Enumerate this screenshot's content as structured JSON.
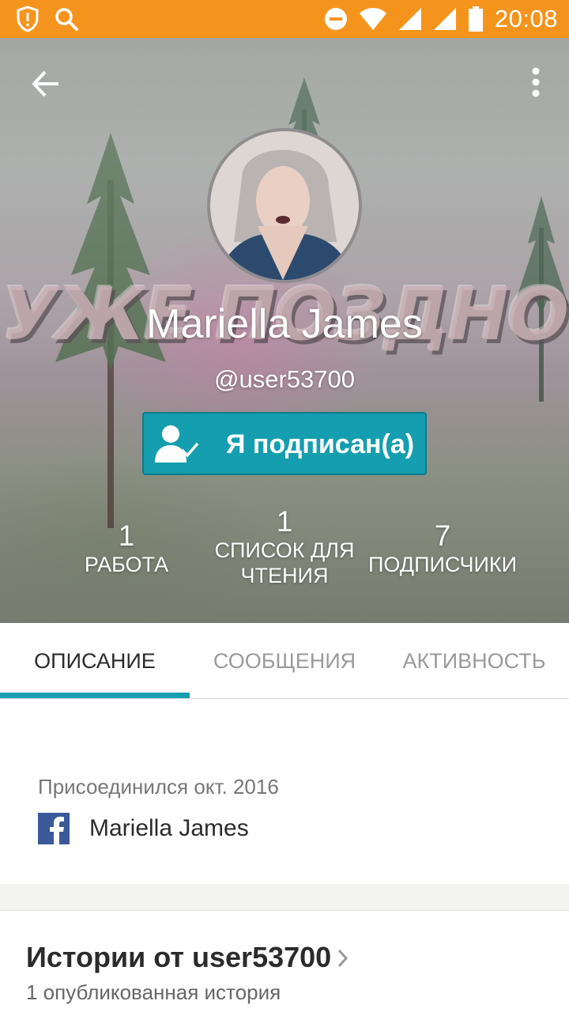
{
  "status_bar": {
    "time": "20:08",
    "icons": [
      "shield-alert-icon",
      "search-icon",
      "do-not-disturb-icon",
      "wifi-icon",
      "signal-icon",
      "signal-icon",
      "battery-icon"
    ],
    "color": "#f5941d"
  },
  "header": {
    "background_text": "УЖЕ ПОЗДНО",
    "display_name": "Mariella James",
    "username": "@user53700",
    "follow_button_label": "Я подписан(а)",
    "accent_color": "#149eaf"
  },
  "stats": {
    "works": {
      "count": "1",
      "label": "РАБОТА"
    },
    "reading_lists": {
      "count": "1",
      "label": "СПИСОК ДЛЯ ЧТЕНИЯ"
    },
    "followers": {
      "count": "7",
      "label": "ПОДПИСЧИКИ"
    }
  },
  "tabs": [
    {
      "label": "ОПИСАНИЕ",
      "active": true
    },
    {
      "label": "СООБЩЕНИЯ",
      "active": false
    },
    {
      "label": "АКТИВНОСТЬ",
      "active": false
    }
  ],
  "about": {
    "joined": "Присоединился окт. 2016",
    "facebook_name": "Mariella James"
  },
  "stories": {
    "title": "Истории от user53700",
    "subtitle": "1 опубликованная история"
  }
}
